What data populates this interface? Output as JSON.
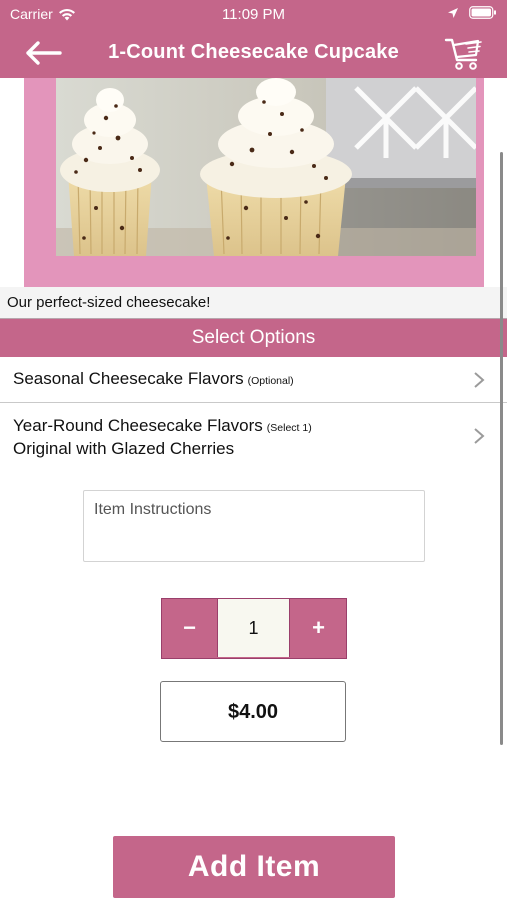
{
  "status_bar": {
    "carrier": "Carrier",
    "time": "11:09 PM"
  },
  "nav": {
    "title": "1-Count Cheesecake Cupcake",
    "back_icon": "arrow-left-icon",
    "cart_icon": "shopping-cart-icon"
  },
  "product": {
    "image": "cheesecake-cupcakes-photo",
    "description": "Our perfect-sized cheesecake!"
  },
  "options": {
    "header": "Select Options",
    "items": [
      {
        "label": "Seasonal Cheesecake Flavors",
        "tag": "(Optional)",
        "selected": ""
      },
      {
        "label": "Year-Round Cheesecake Flavors",
        "tag": "(Select 1)",
        "selected": "Original with Glazed Cherries"
      }
    ]
  },
  "instructions": {
    "placeholder": "Item Instructions",
    "value": ""
  },
  "quantity": {
    "minus": "−",
    "value": "1",
    "plus": "+"
  },
  "price": "$4.00",
  "add_button": "Add Item",
  "colors": {
    "brand": "#c4668a",
    "hero_border": "#e395bb",
    "stepper_border": "#9a3f6b"
  }
}
